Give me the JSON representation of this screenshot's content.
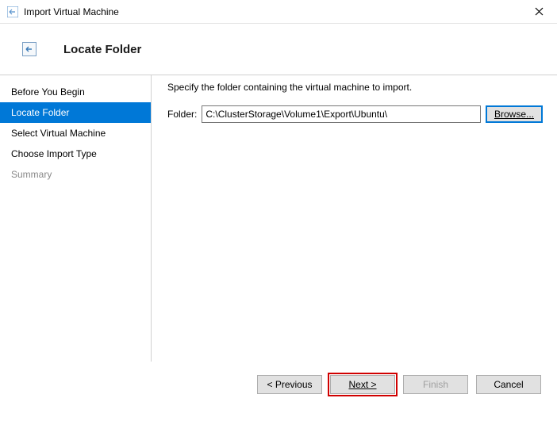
{
  "window": {
    "title": "Import Virtual Machine"
  },
  "header": {
    "title": "Locate Folder"
  },
  "sidebar": {
    "items": [
      {
        "label": "Before You Begin",
        "selected": false,
        "disabled": false
      },
      {
        "label": "Locate Folder",
        "selected": true,
        "disabled": false
      },
      {
        "label": "Select Virtual Machine",
        "selected": false,
        "disabled": false
      },
      {
        "label": "Choose Import Type",
        "selected": false,
        "disabled": false
      },
      {
        "label": "Summary",
        "selected": false,
        "disabled": true
      }
    ]
  },
  "main": {
    "instruction": "Specify the folder containing the virtual machine to import.",
    "folder_label": "Folder:",
    "folder_value": "C:\\ClusterStorage\\Volume1\\Export\\Ubuntu\\",
    "browse_label": "Browse..."
  },
  "buttons": {
    "previous": "< Previous",
    "next": "Next >",
    "finish": "Finish",
    "cancel": "Cancel"
  }
}
